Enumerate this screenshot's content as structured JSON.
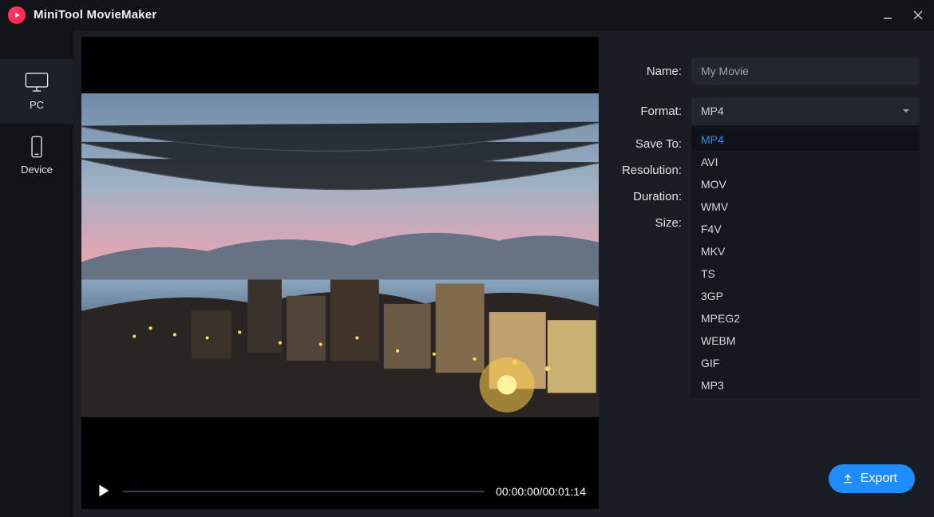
{
  "app": {
    "title": "MiniTool MovieMaker"
  },
  "sidebar": {
    "tabs": [
      {
        "id": "pc",
        "label": "PC",
        "active": true
      },
      {
        "id": "device",
        "label": "Device",
        "active": false
      }
    ]
  },
  "preview": {
    "time_current": "00:00:00",
    "time_total": "00:01:14",
    "time_display": "00:00:00/00:01:14"
  },
  "panel": {
    "labels": {
      "name": "Name:",
      "format": "Format:",
      "save_to": "Save To:",
      "resolution": "Resolution:",
      "duration": "Duration:",
      "size": "Size:"
    },
    "name_value": "My Movie",
    "format_selected": "MP4",
    "format_options": [
      "MP4",
      "AVI",
      "MOV",
      "WMV",
      "F4V",
      "MKV",
      "TS",
      "3GP",
      "MPEG2",
      "WEBM",
      "GIF",
      "MP3"
    ],
    "export_label": "Export"
  },
  "colors": {
    "accent": "#1f8cff",
    "brand": "#ff2a55",
    "panel_bg": "#1a1d24",
    "titlebar_bg": "#12141a",
    "input_bg": "#222631"
  }
}
